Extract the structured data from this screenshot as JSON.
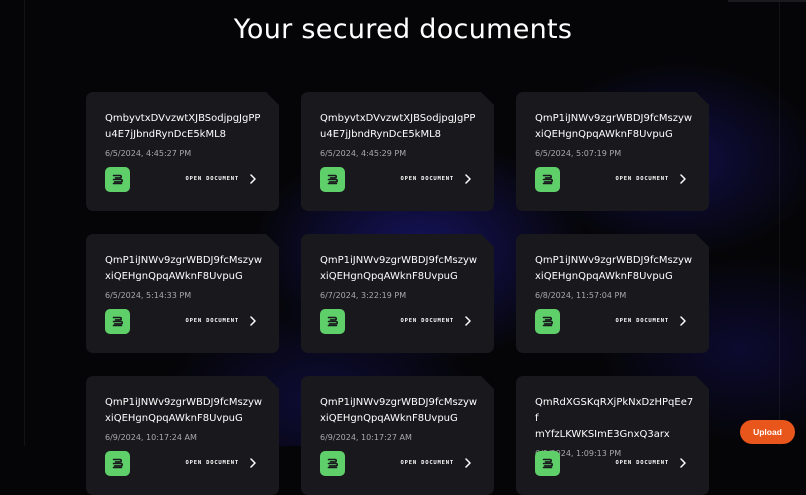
{
  "page": {
    "title": "Your secured documents"
  },
  "documents": [
    {
      "id_line1": "QmbyvtxDVvzwtXJBSodjpgJgPP",
      "id_line2": "u4E7jJbndRynDcE5kML8",
      "date": "6/5/2024, 4:45:27 PM",
      "open_label": "OPEN DOCUMENT"
    },
    {
      "id_line1": "QmbyvtxDVvzwtXJBSodjpgJgPP",
      "id_line2": "u4E7jJbndRynDcE5kML8",
      "date": "6/5/2024, 4:45:29 PM",
      "open_label": "OPEN DOCUMENT"
    },
    {
      "id_line1": "QmP1iJNWv9zgrWBDJ9fcMszyw",
      "id_line2": "xiQEHgnQpqAWknF8UvpuG",
      "date": "6/5/2024, 5:07:19 PM",
      "open_label": "OPEN DOCUMENT"
    },
    {
      "id_line1": "QmP1iJNWv9zgrWBDJ9fcMszyw",
      "id_line2": "xiQEHgnQpqAWknF8UvpuG",
      "date": "6/5/2024, 5:14:33 PM",
      "open_label": "OPEN DOCUMENT"
    },
    {
      "id_line1": "QmP1iJNWv9zgrWBDJ9fcMszyw",
      "id_line2": "xiQEHgnQpqAWknF8UvpuG",
      "date": "6/7/2024, 3:22:19 PM",
      "open_label": "OPEN DOCUMENT"
    },
    {
      "id_line1": "QmP1iJNWv9zgrWBDJ9fcMszyw",
      "id_line2": "xiQEHgnQpqAWknF8UvpuG",
      "date": "6/8/2024, 11:57:04 PM",
      "open_label": "OPEN DOCUMENT"
    },
    {
      "id_line1": "QmP1iJNWv9zgrWBDJ9fcMszyw",
      "id_line2": "xiQEHgnQpqAWknF8UvpuG",
      "date": "6/9/2024, 10:17:24 AM",
      "open_label": "OPEN DOCUMENT"
    },
    {
      "id_line1": "QmP1iJNWv9zgrWBDJ9fcMszyw",
      "id_line2": "xiQEHgnQpqAWknF8UvpuG",
      "date": "6/9/2024, 10:17:27 AM",
      "open_label": "OPEN DOCUMENT"
    },
    {
      "id_line1": "QmRdXGSKqRXjPkNxDzHPqEe7f",
      "id_line2": "mYfzLKWKSImE3GnxQ3arx",
      "date": "6/9/2024, 1:09:13 PM",
      "open_label": "OPEN DOCUMENT"
    }
  ],
  "upload": {
    "label": "Upload"
  },
  "icons": {
    "document": "document-stack-icon",
    "chevron": "chevron-right-icon"
  },
  "colors": {
    "background": "#050508",
    "card": "#18181d",
    "accent_green": "#5fcf6a",
    "upload_orange": "#e8561c"
  }
}
